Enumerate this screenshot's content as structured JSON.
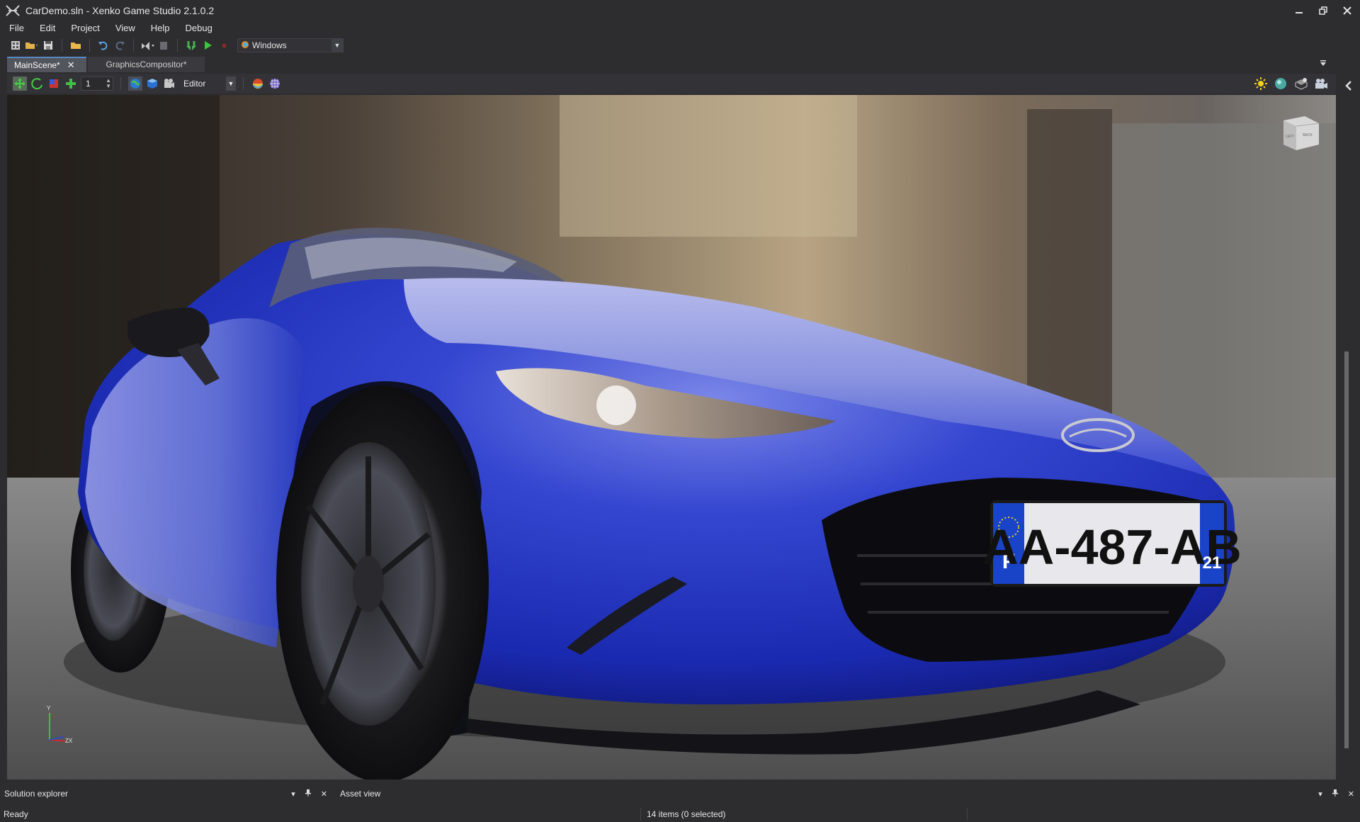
{
  "window": {
    "title": "CarDemo.sln - Xenko Game Studio 2.1.0.2",
    "logo_icon": "xenko-logo-icon",
    "controls": [
      "minimize-icon",
      "restore-icon",
      "close-icon"
    ]
  },
  "menu": {
    "items": [
      "File",
      "Edit",
      "Project",
      "View",
      "Help",
      "Debug"
    ]
  },
  "toolbar": {
    "platform": "Windows",
    "icons": [
      "new-project-icon",
      "open-icon",
      "save-icon",
      "open-folder-icon",
      "undo-icon",
      "redo-icon",
      "visual-studio-icon",
      "package-icon",
      "build-icon",
      "play-icon",
      "stop-icon"
    ]
  },
  "tabs": {
    "active": "MainScene*",
    "inactive": "GraphicsCompositor*"
  },
  "scene_toolbar": {
    "snap_value": "1",
    "camera_mode": "Editor",
    "left_icons": [
      "translate-gizmo-icon",
      "rotate-gizmo-icon",
      "scale-gizmo-icon",
      "snap-icon"
    ],
    "view_icons": [
      "world-space-icon",
      "cube-icon",
      "camera-settings-icon"
    ],
    "render_icons": [
      "materials-icon",
      "wireframe-icon"
    ],
    "right_icons": [
      "lighting-icon",
      "skybox-icon",
      "navigation-icon",
      "camera-preview-icon"
    ]
  },
  "viewport": {
    "license_plate": {
      "country": "F",
      "number": "AA-487-AB",
      "region": "21"
    },
    "view_cube": {
      "left_face": "LEFT",
      "right_face": "BACK"
    },
    "axis": {
      "y": "Y",
      "zx": "ZX"
    },
    "colors": {
      "car_body": "#1e36c8",
      "ground": "#6f6f6f"
    }
  },
  "panels": {
    "solution_explorer": "Solution explorer",
    "asset_view": "Asset view"
  },
  "status": {
    "left": "Ready",
    "items": "14 items (0 selected)"
  }
}
